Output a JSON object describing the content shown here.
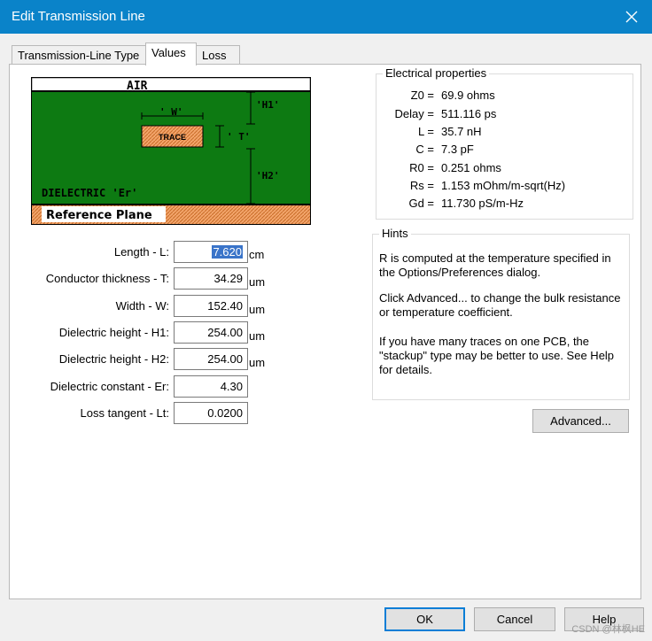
{
  "window": {
    "title": "Edit Transmission Line"
  },
  "tabs": [
    {
      "label": "Transmission-Line Type"
    },
    {
      "label": "Values"
    },
    {
      "label": "Loss"
    }
  ],
  "diagram": {
    "air": "AIR",
    "trace": "TRACE",
    "w": "' W'",
    "t": "' T'",
    "h1": "'H1'",
    "h2": "'H2'",
    "dielectric": "DIELECTRIC 'Er'",
    "reference": "Reference Plane",
    "colors": {
      "dielectric": "#0d7a12",
      "trace": "#f3a56b",
      "plane": "#f3a56b"
    }
  },
  "form": {
    "length": {
      "label": "Length - L:",
      "value": "7.620",
      "unit": "cm"
    },
    "thickness": {
      "label": "Conductor thickness - T:",
      "value": "34.29",
      "unit": "um"
    },
    "width": {
      "label": "Width - W:",
      "value": "152.40",
      "unit": "um"
    },
    "h1": {
      "label": "Dielectric height - H1:",
      "value": "254.00",
      "unit": "um"
    },
    "h2": {
      "label": "Dielectric height - H2:",
      "value": "254.00",
      "unit": "um"
    },
    "er": {
      "label": "Dielectric constant - Er:",
      "value": "4.30"
    },
    "lt": {
      "label": "Loss tangent - Lt:",
      "value": "0.0200"
    }
  },
  "electrical": {
    "title": "Electrical properties",
    "rows": [
      {
        "key": "Z0 =",
        "value": "69.9 ohms"
      },
      {
        "key": "Delay =",
        "value": "511.116 ps"
      },
      {
        "key": "L =",
        "value": "35.7 nH"
      },
      {
        "key": "C =",
        "value": "7.3 pF"
      },
      {
        "key": "R0 =",
        "value": "0.251 ohms"
      },
      {
        "key": "Rs =",
        "value": "1.153 mOhm/m-sqrt(Hz)"
      },
      {
        "key": "Gd =",
        "value": "11.730 pS/m-Hz"
      }
    ]
  },
  "hints": {
    "title": "Hints",
    "p1": "R is computed at the temperature specified in the Options/Preferences dialog.",
    "p2": "Click Advanced... to change the bulk resistance or temperature coefficient.",
    "p3": "If you have many traces on one PCB, the \"stackup\" type may be better to use.  See Help for details."
  },
  "buttons": {
    "advanced": "Advanced...",
    "ok": "OK",
    "cancel": "Cancel",
    "help": "Help"
  },
  "watermark": "CSDN @林枫HE"
}
